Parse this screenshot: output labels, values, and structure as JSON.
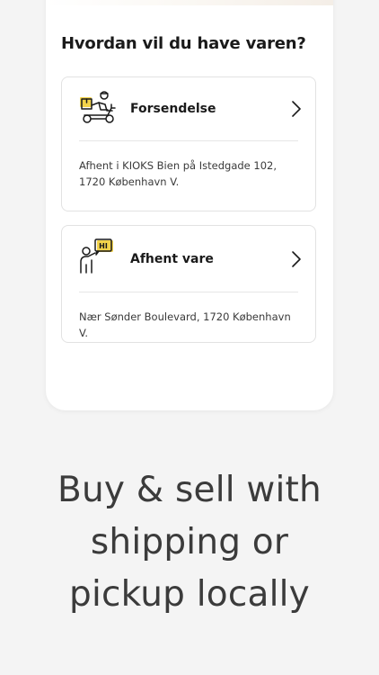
{
  "screen": {
    "heading": "Hvordan vil du have varen?",
    "options": [
      {
        "title": "Forsendelse",
        "detail": "Afhent i KIOKS Bien på Istedgade 102, 1720 København V.",
        "icon": "delivery-scooter-icon"
      },
      {
        "title": "Afhent vare",
        "detail": "Nær Sønder Boulevard, 1720 København V.",
        "icon": "person-speech-hi-icon",
        "icon_text": "HI"
      }
    ]
  },
  "tagline": {
    "line1": "Buy & sell with",
    "line2": "shipping or",
    "line3": "pickup locally"
  },
  "colors": {
    "background": "#f4f4f4",
    "card": "#ffffff",
    "icon_accent": "#f3d34a",
    "text": "#1a1a1a"
  }
}
